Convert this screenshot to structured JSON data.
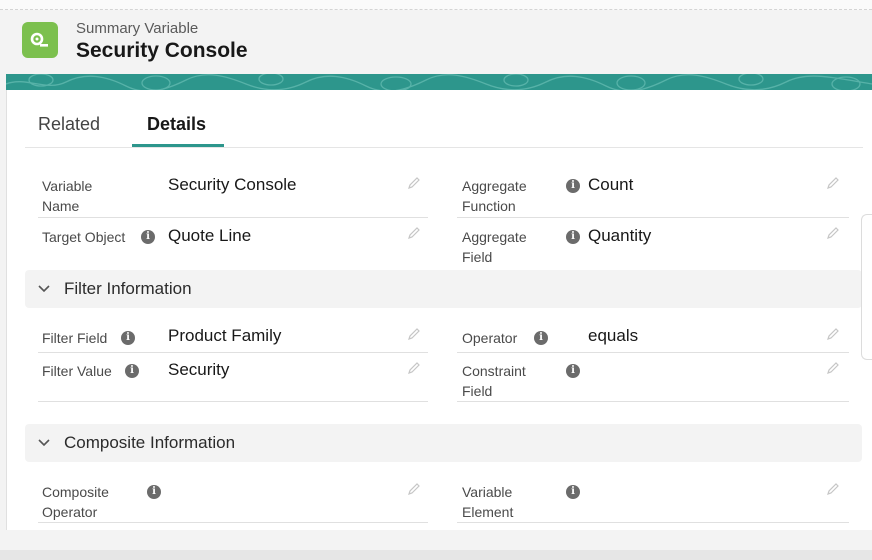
{
  "header": {
    "subtitle": "Summary Variable",
    "title": "Security Console",
    "icon": "summary-variable-icon",
    "brand_color": "#7cc04e",
    "banner_color": "#2d968c"
  },
  "tabs": [
    {
      "label": "Related",
      "active": false
    },
    {
      "label": "Details",
      "active": true
    }
  ],
  "details": {
    "variable_name_label": "Variable Name",
    "variable_name_value": "Security Console",
    "aggregate_function_label": "Aggregate Function",
    "aggregate_function_value": "Count",
    "target_object_label": "Target Object",
    "target_object_value": "Quote Line",
    "aggregate_field_label": "Aggregate Field",
    "aggregate_field_value": "Quantity"
  },
  "filter_section": {
    "title": "Filter Information",
    "filter_field_label": "Filter Field",
    "filter_field_value": "Product Family",
    "operator_label": "Operator",
    "operator_value": "equals",
    "filter_value_label": "Filter Value",
    "filter_value_value": "Security",
    "constraint_field_label": "Constraint Field",
    "constraint_field_value": ""
  },
  "composite_section": {
    "title": "Composite Information",
    "composite_operator_label": "Composite Operator",
    "composite_operator_value": "",
    "variable_element_label": "Variable Element",
    "variable_element_value": ""
  }
}
